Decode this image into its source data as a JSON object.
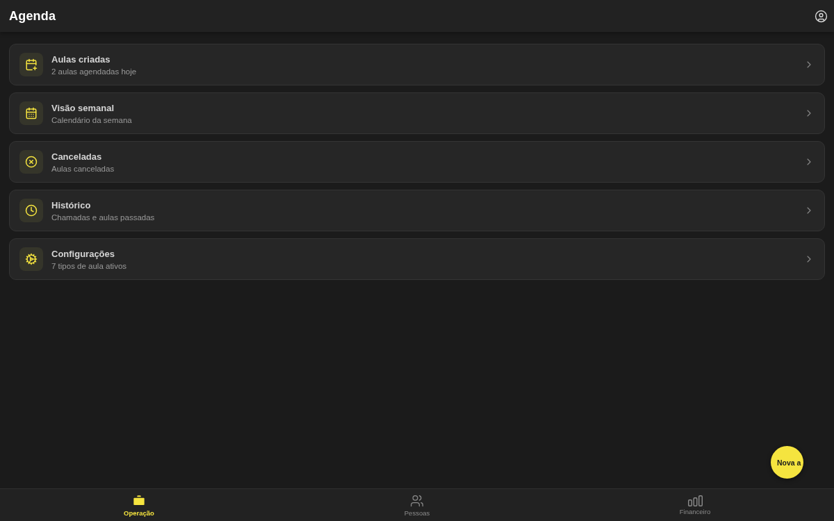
{
  "header": {
    "title": "Agenda"
  },
  "menu_items": [
    {
      "kind": "calendar-plus",
      "title": "Aulas criadas",
      "subtitle": "2 aulas agendadas hoje"
    },
    {
      "kind": "calendar-week",
      "title": "Visão semanal",
      "subtitle": "Calendário da semana"
    },
    {
      "kind": "cancel",
      "title": "Canceladas",
      "subtitle": "Aulas canceladas"
    },
    {
      "kind": "history",
      "title": "Histórico",
      "subtitle": "Chamadas e aulas passadas"
    },
    {
      "kind": "settings",
      "title": "Configurações",
      "subtitle": "7 tipos de aula ativos"
    }
  ],
  "fab": {
    "label": "Nova a"
  },
  "bottom_nav": [
    {
      "kind": "operation",
      "label": "Operação",
      "selected": true
    },
    {
      "kind": "people",
      "label": "Pessoas",
      "selected": false
    },
    {
      "kind": "finance",
      "label": "Financeiro",
      "selected": false
    }
  ]
}
